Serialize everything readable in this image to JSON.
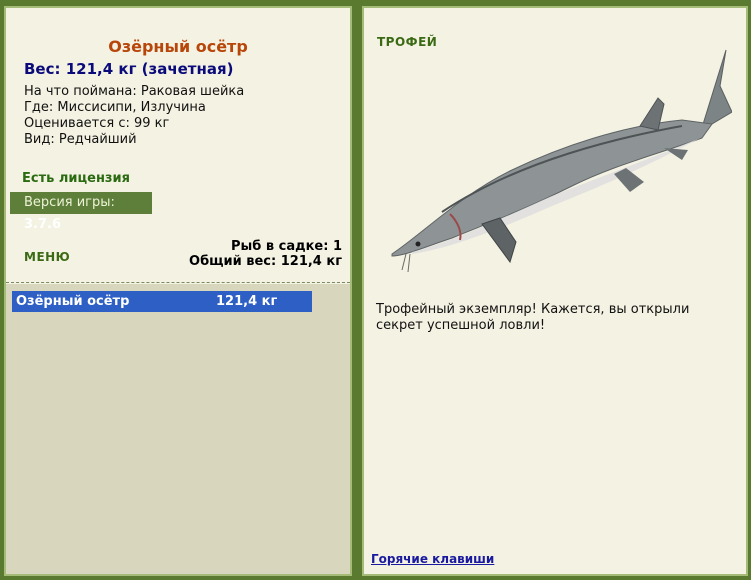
{
  "fish": {
    "title": "Озёрный осётр",
    "weight_line": "Вес: 121,4 кг (зачетная)",
    "bait_line": "На что поймана: Раковая шейка",
    "location_line": "Где: Миссисипи, Излучина",
    "valued_line": "Оценивается с: 99 кг",
    "kind_line": "Вид: Редчайший"
  },
  "license_text": "Есть лицензия",
  "version": {
    "label": "Версия игры:",
    "value": "3.7.6"
  },
  "menu_label": "МЕНЮ",
  "keep_net": {
    "count_line": "Рыб в садке: 1",
    "total_line": "Общий вес: 121,4 кг"
  },
  "catch_list": [
    {
      "name": "Озёрный осётр",
      "weight": "121,4 кг"
    }
  ],
  "trophy": {
    "heading": "ТРОФЕЙ",
    "message": "Трофейный экземпляр! Кажется, вы открыли секрет успешной ловли!"
  },
  "hotkeys_link": "Горячие клавиши",
  "colors": {
    "frame": "#5a7a30",
    "panel_bg": "#f4f2e2",
    "title_orange": "#b8460a",
    "weight_blue": "#0a0a7a",
    "selected_row": "#2d5fc4",
    "version_bar": "#5d7f3a"
  }
}
